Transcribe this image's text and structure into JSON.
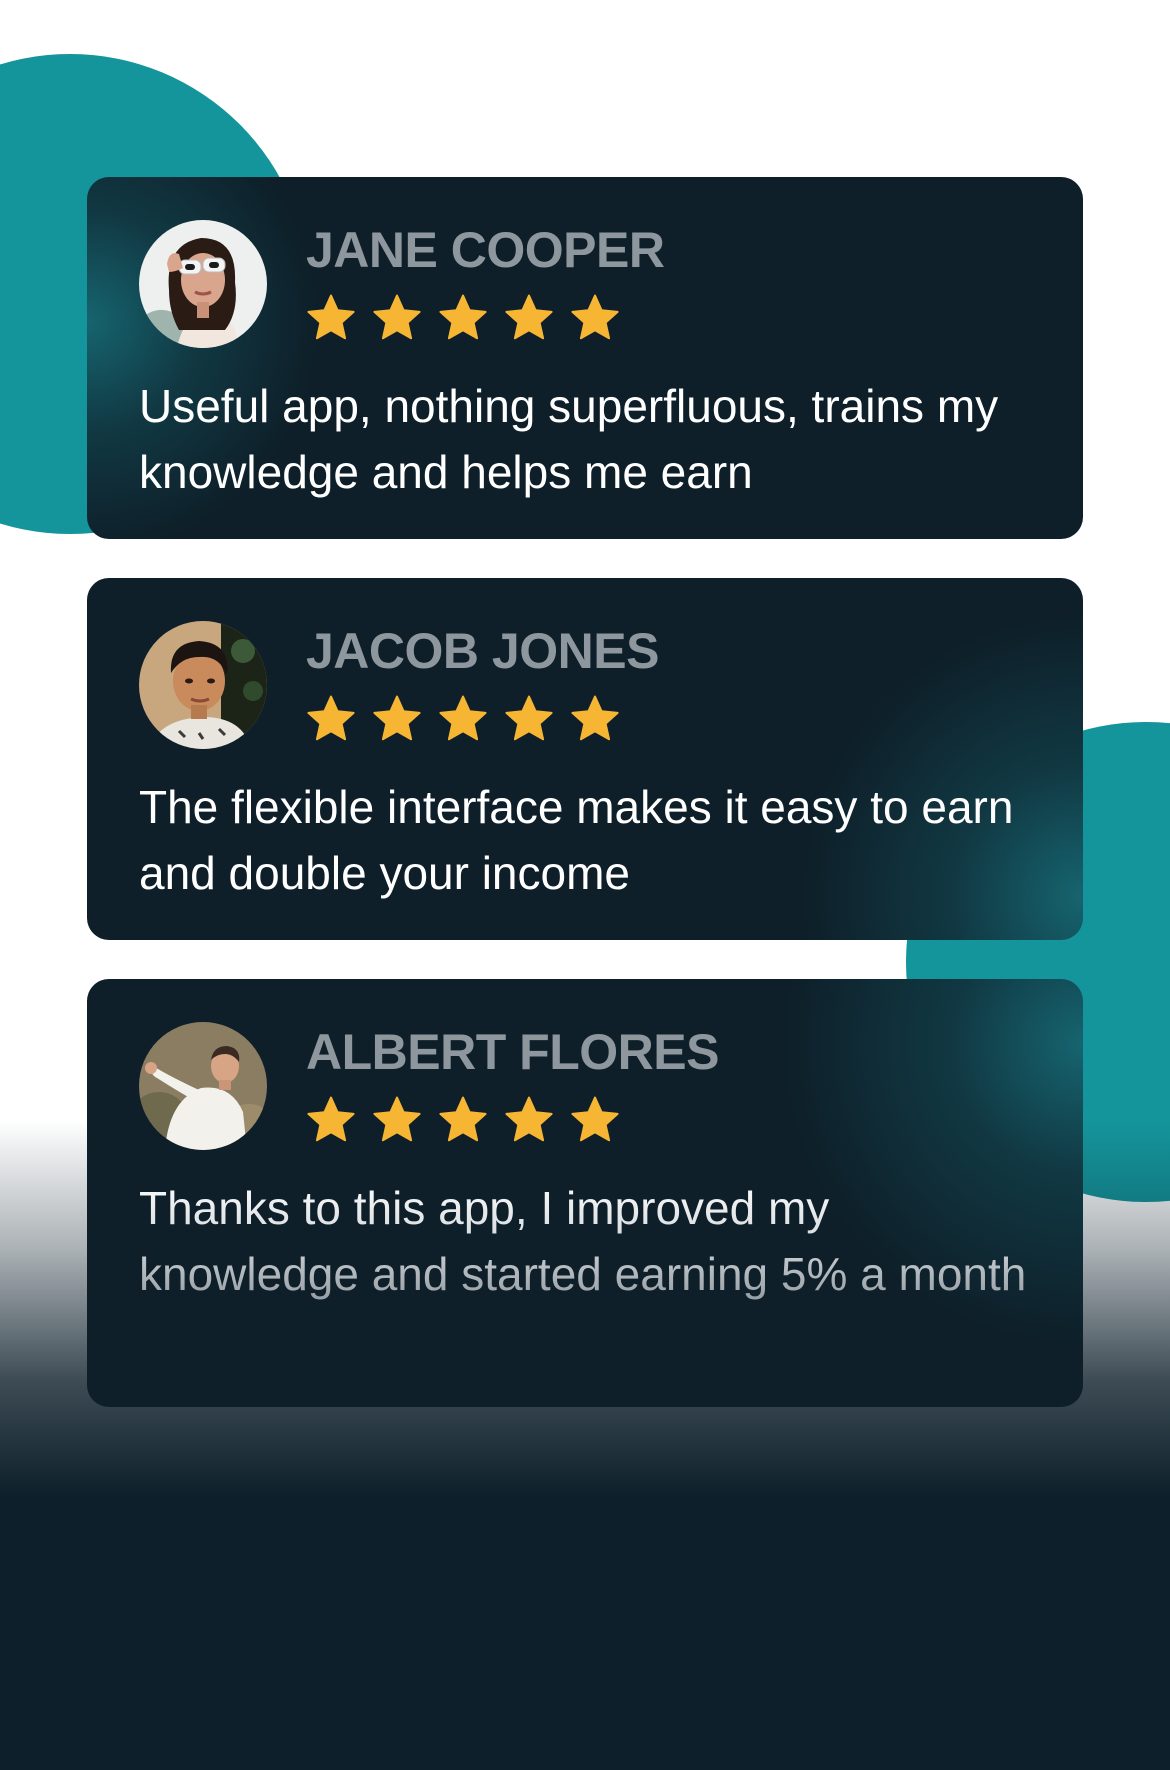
{
  "colors": {
    "card_background": "#0e1f29",
    "accent_teal": "#14959b",
    "star": "#f7b534",
    "name_text": "#8e979e",
    "review_text": "#ffffff"
  },
  "reviews": [
    {
      "name": "JANE COOPER",
      "rating": 5,
      "rating_max": 5,
      "avatar_icon": "woman-with-sunglasses-avatar",
      "text": "Useful app, nothing superfluous, trains my knowledge and helps me earn"
    },
    {
      "name": "JACOB JONES",
      "rating": 5,
      "rating_max": 5,
      "avatar_icon": "young-man-avatar",
      "text": "The flexible interface makes it easy to earn and double your income"
    },
    {
      "name": "ALBERT FLORES",
      "rating": 5,
      "rating_max": 5,
      "avatar_icon": "man-white-shirt-avatar",
      "text": "Thanks to this app, I improved my knowledge and started earning 5% a month"
    }
  ]
}
